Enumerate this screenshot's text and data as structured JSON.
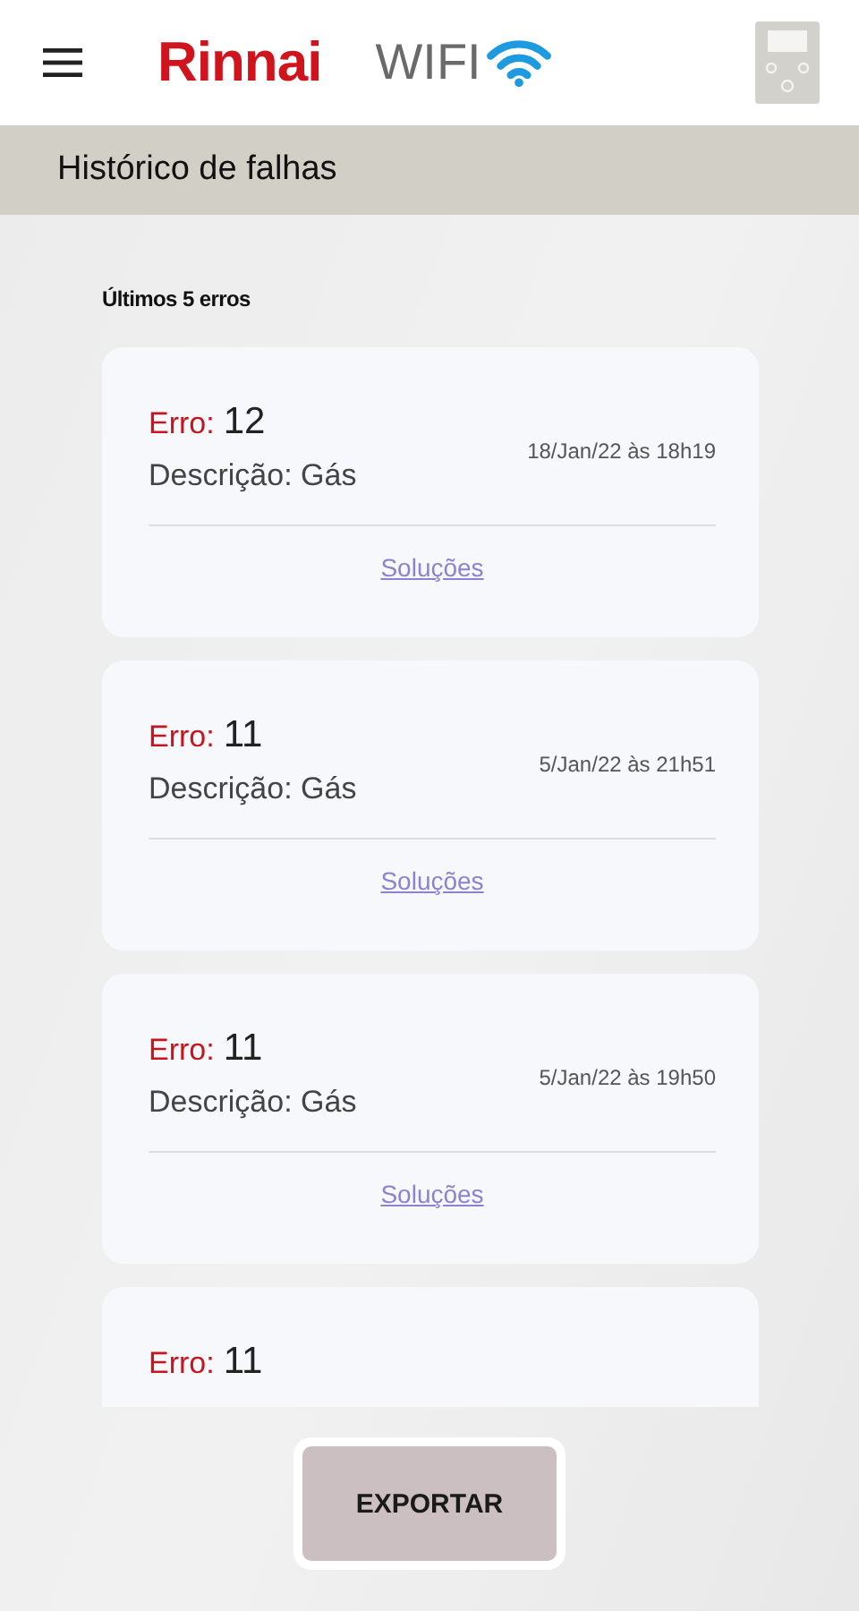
{
  "header": {
    "brand": "Rinnai",
    "brand_suffix": "WIFI"
  },
  "title_bar": {
    "title": "Histórico de falhas"
  },
  "list": {
    "heading": "Últimos 5 erros",
    "errors": [
      {
        "label": "Erro:",
        "code": "12",
        "description": "Descrição: Gás",
        "date": "18/Jan/22 às 18h19",
        "link": "Soluções"
      },
      {
        "label": "Erro:",
        "code": "11",
        "description": "Descrição: Gás",
        "date": "5/Jan/22 às 21h51",
        "link": "Soluções"
      },
      {
        "label": "Erro:",
        "code": "11",
        "description": "Descrição: Gás",
        "date": "5/Jan/22 às 19h50",
        "link": "Soluções"
      },
      {
        "label": "Erro:",
        "code": "11"
      }
    ]
  },
  "export_button": "EXPORTAR"
}
